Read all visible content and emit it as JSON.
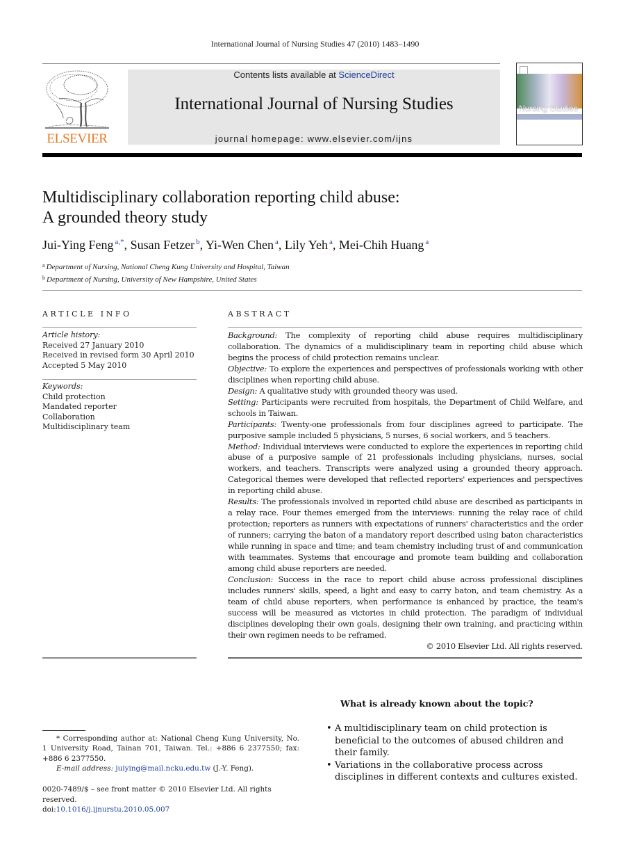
{
  "running_head": "International Journal of Nursing Studies 47 (2010) 1483–1490",
  "publisher": {
    "logo_text": "ELSEVIER",
    "logo_color": "#e47a25"
  },
  "banner": {
    "contents_prefix": "Contents lists available at ",
    "contents_link": "ScienceDirect",
    "journal_title": "International Journal of Nursing Studies",
    "homepage": "journal homepage: www.elsevier.com/ijns",
    "background": "#e6e6e6",
    "link_color": "#1f3f9a"
  },
  "cover": {
    "title": "Nursing Studies"
  },
  "article": {
    "title_line1": "Multidisciplinary collaboration reporting child abuse:",
    "title_line2": "A grounded theory study",
    "authors": [
      {
        "name": "Jui-Ying Feng",
        "sup": "a,*",
        "sep": ", "
      },
      {
        "name": "Susan Fetzer",
        "sup": "b",
        "sep": ", "
      },
      {
        "name": "Yi-Wen Chen",
        "sup": "a",
        "sep": ", "
      },
      {
        "name": "Lily Yeh",
        "sup": "a",
        "sep": ", "
      },
      {
        "name": "Mei-Chih Huang",
        "sup": "a",
        "sep": ""
      }
    ],
    "affiliations": [
      {
        "mark": "a",
        "text": "Department of Nursing, National Cheng Kung University and Hospital, Taiwan"
      },
      {
        "mark": "b",
        "text": "Department of Nursing, University of New Hampshire, United States"
      }
    ]
  },
  "article_info": {
    "heading": "ARTICLE INFO",
    "history_label": "Article history:",
    "history": [
      "Received 27 January 2010",
      "Received in revised form 30 April 2010",
      "Accepted 5 May 2010"
    ],
    "keywords_label": "Keywords:",
    "keywords": [
      "Child protection",
      "Mandated reporter",
      "Collaboration",
      "Multidisciplinary team"
    ]
  },
  "abstract": {
    "heading": "ABSTRACT",
    "sections": [
      {
        "label": "Background:",
        "text": "The complexity of reporting child abuse requires multidisciplinary collaboration. The dynamics of a mulidisciplinary team in reporting child abuse which begins the process of child protection remains unclear."
      },
      {
        "label": "Objective:",
        "text": "To explore the experiences and perspectives of professionals working with other disciplines when reporting child abuse."
      },
      {
        "label": "Design:",
        "text": "A qualitative study with grounded theory was used."
      },
      {
        "label": "Setting:",
        "text": "Participants were recruited from hospitals, the Department of Child Welfare, and schools in Taiwan."
      },
      {
        "label": "Participants:",
        "text": "Twenty-one professionals from four disciplines agreed to participate. The purposive sample included 5 physicians, 5 nurses, 6 social workers, and 5 teachers."
      },
      {
        "label": "Method:",
        "text": "Individual interviews were conducted to explore the experiences in reporting child abuse of a purposive sample of 21 professionals including physicians, nurses, social workers, and teachers. Transcripts were analyzed using a grounded theory approach. Categorical themes were developed that reflected reporters' experiences and perspectives in reporting child abuse."
      },
      {
        "label": "Results:",
        "text": "The professionals involved in reported child abuse are described as participants in a relay race. Four themes emerged from the interviews: running the relay race of child protection; reporters as runners with expectations of runners' characteristics and the order of runners; carrying the baton of a mandatory report described using baton characteristics while running in space and time; and team chemistry including trust of and communication with teammates. Systems that encourage and promote team building and collaboration among child abuse reporters are needed."
      },
      {
        "label": "Conclusion:",
        "text": "Success in the race to report child abuse across professional disciplines includes runners' skills, speed, a light and easy to carry baton, and team chemistry. As a team of child abuse reporters, when performance is enhanced by practice, the team's success will be measured as victories in child protection. The paradigm of individual disciplines developing their own goals, designing their own training, and practicing within their own regimen needs to be reframed."
      }
    ],
    "copyright": "© 2010 Elsevier Ltd. All rights reserved."
  },
  "known": {
    "title": "What is already known about the topic?",
    "bullet": "•",
    "items": [
      "A multidisciplinary team on child protection is beneficial to the outcomes of abused children and their family.",
      "Variations in the collaborative process across disciplines in different contexts and cultures existed."
    ]
  },
  "footnote": {
    "corresponding": "* Corresponding author at: National Cheng Kung University, No. 1 University Road, Tainan 701, Taiwan. Tel.: +886 6 2377550; fax: +886 6 2377550.",
    "email_label": "E-mail address:",
    "email": "juiying@mail.ncku.edu.tw",
    "email_suffix": " (J.-Y. Feng)."
  },
  "front_matter": {
    "issn_line": "0020-7489/$ – see front matter © 2010 Elsevier Ltd. All rights reserved.",
    "doi_prefix": "doi:",
    "doi": "10.1016/j.ijnurstu.2010.05.007"
  }
}
